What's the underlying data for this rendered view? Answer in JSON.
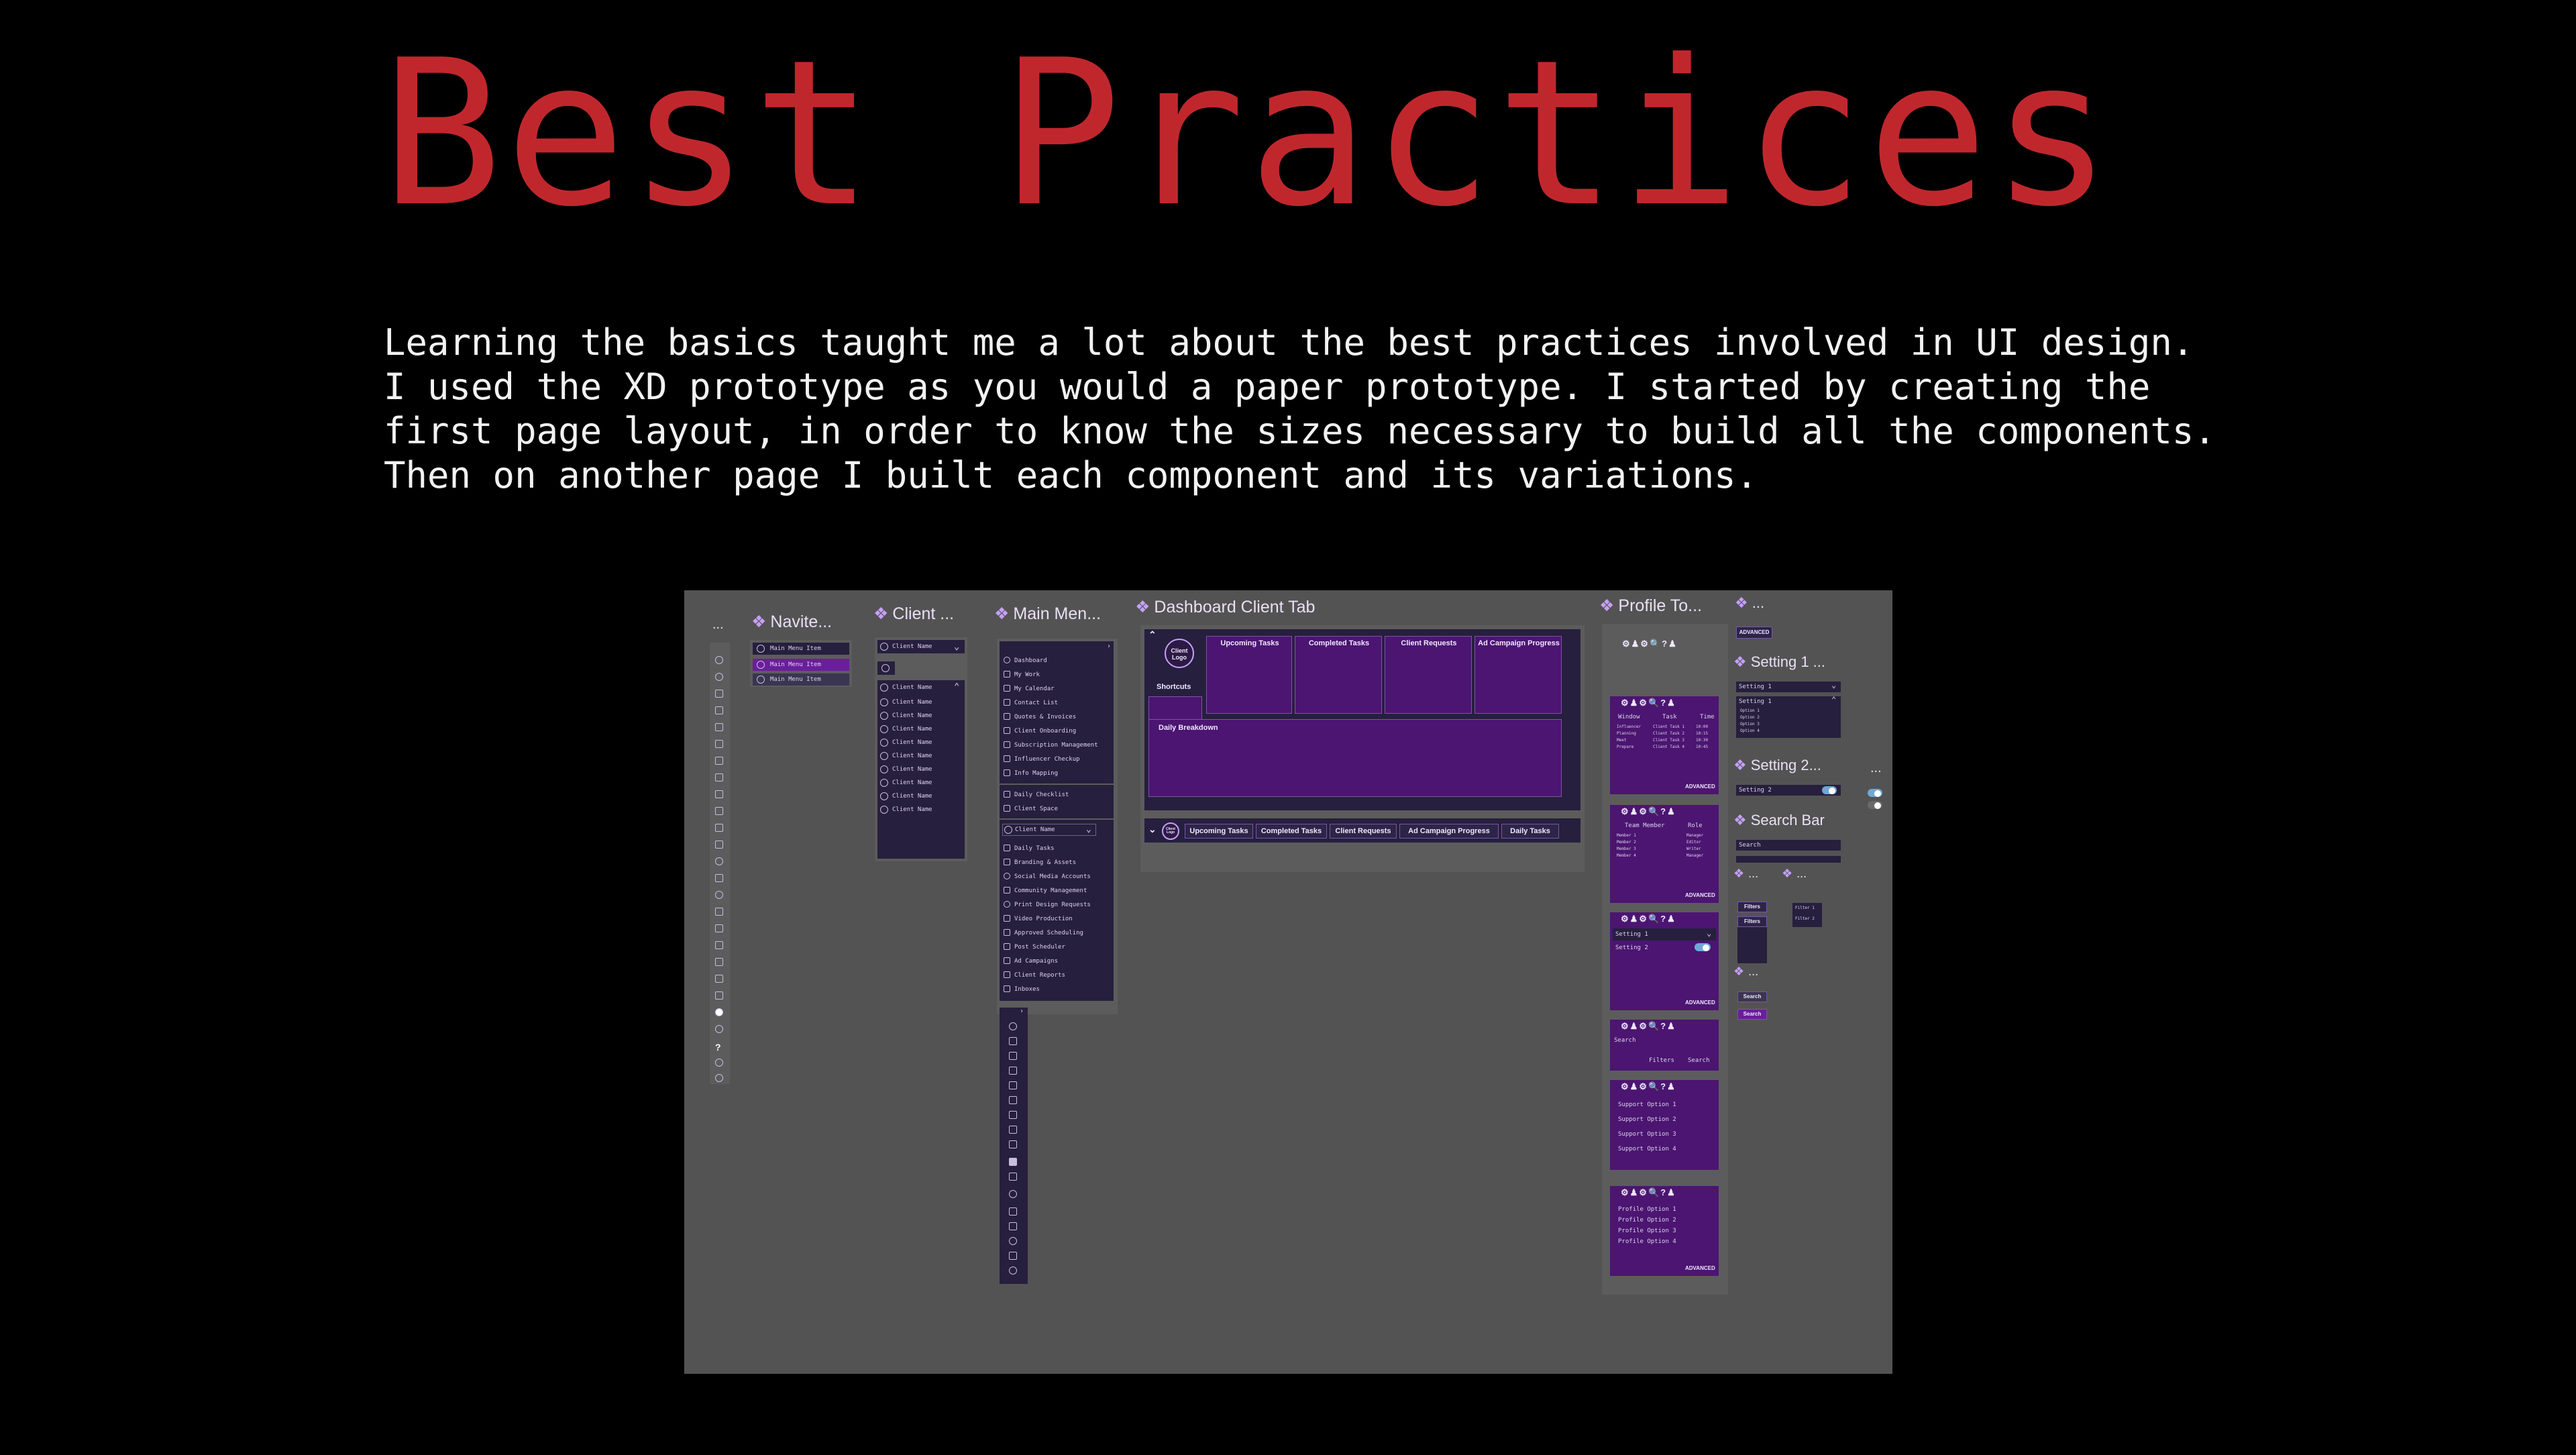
{
  "page": {
    "title": "Best Practices",
    "description": "Learning the basics taught me a lot about the best practices involved in UI design. I used the XD prototype as you would a paper prototype. I started by creating the first page layout, in order to know the sizes necessary to build all the components. Then on another page I built each component and its variations."
  },
  "artboards": {
    "ellipsis_label": "...",
    "navitem": {
      "label": "Navite...",
      "items": [
        "Main Menu Item",
        "Main Menu Item",
        "Main Menu Item"
      ]
    },
    "client": {
      "label": "Client ...",
      "dropdown": "Client Name",
      "items": [
        "Client Name",
        "Client Name",
        "Client Name",
        "Client Name",
        "Client Name",
        "Client Name",
        "Client Name",
        "Client Name",
        "Client Name",
        "Client Name"
      ]
    },
    "main_menu": {
      "label": "Main Men...",
      "items_top": [
        "Dashboard",
        "My Work",
        "My Calendar",
        "Contact List",
        "Quotes & Invoices",
        "Client Onboarding",
        "Subscription Management",
        "Influencer Checkup",
        "Info Mapping"
      ],
      "items_mid": [
        "Daily Checklist",
        "Client Space"
      ],
      "client_dropdown": "Client Name",
      "items_client": [
        "Daily Tasks",
        "Branding & Assets",
        "Social Media Accounts",
        "Community Management",
        "Print Design Requests",
        "Video Production",
        "Approved Scheduling",
        "Post Scheduler",
        "Ad Campaigns",
        "Client Reports",
        "Inboxes"
      ]
    },
    "dashboard": {
      "label": "Dashboard Client Tab",
      "logo": "Client Logo",
      "shortcuts": "Shortcuts",
      "tiles": [
        "Upcoming Tasks",
        "Completed Tasks",
        "Client Requests",
        "Ad Campaign Progress"
      ],
      "daily": "Daily Breakdown",
      "tabs": [
        "Upcoming Tasks",
        "Completed Tasks",
        "Client Requests",
        "Ad Campaign Progress",
        "Daily Tasks"
      ],
      "mini_logo": "Client Logo"
    },
    "profile": {
      "label": "Profile To...",
      "advanced": "ADVANCED",
      "table1_headers": [
        "Window",
        "Task",
        "Time"
      ],
      "table1_rows": [
        [
          "Influencer",
          "Client Task 1",
          "10:00"
        ],
        [
          "Planning",
          "Client Task 2",
          "10:15"
        ],
        [
          "Meet",
          "Client Task 3",
          "10:30"
        ],
        [
          "Prepare",
          "Client Task 4",
          "10:45"
        ]
      ],
      "table2_headers": [
        "Team Member",
        "Role"
      ],
      "table2_rows": [
        [
          "Member 1",
          "Manager"
        ],
        [
          "Member 2",
          "Editor"
        ],
        [
          "Member 3",
          "Writer"
        ],
        [
          "Member 4",
          "Manager"
        ]
      ],
      "settings_rows": [
        "Setting 1",
        "Setting 2"
      ],
      "search_label": "Search",
      "filters_btn": "Filters",
      "search_btn": "Search",
      "support_options": [
        "Support Option 1",
        "Support Option 2",
        "Support Option 3",
        "Support Option 4"
      ],
      "profile_options": [
        "Profile Option 1",
        "Profile Option 2",
        "Profile Option 3",
        "Profile Option 4"
      ]
    },
    "misc": {
      "label": "...",
      "advanced": "ADVANCED",
      "setting1_label": "Setting 1 ...",
      "setting1_dropdown": "Setting 1",
      "setting1_open": "Setting 1",
      "setting1_options": [
        "Option 1",
        "Option 2",
        "Option 3",
        "Option 4"
      ],
      "setting2_label": "Setting 2...",
      "setting2_row": "Setting 2",
      "trailing": "...",
      "searchbar_label": "Search Bar",
      "search_placeholder": "Search",
      "small_labels": [
        "...",
        "..."
      ],
      "filters": "Filters",
      "filters2": "Filters",
      "filter_opts": [
        "Filter 1",
        "Filter 2"
      ],
      "small_label3": "...",
      "search_btn": "Search",
      "search_btn2": "Search"
    }
  },
  "colors": {
    "title": "#c0272d",
    "canvas": "#535353",
    "component_dark": "#261f3d",
    "component_purple": "#4b1571",
    "accent": "#c6a0ff"
  }
}
